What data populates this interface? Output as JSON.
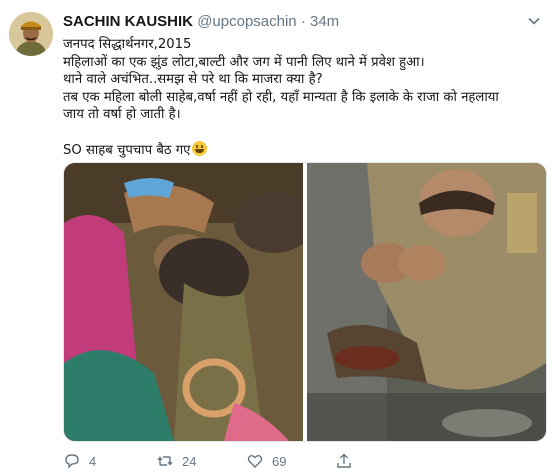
{
  "user": {
    "name": "SACHIN KAUSHIK",
    "handle": "@upcopsachin",
    "separator": "·",
    "time": "34m"
  },
  "tweet": {
    "lines": [
      "जनपद सिद्धार्थनगर,2015",
      "महिलाओं का एक झुंड लोटा,बाल्टी और जग में पानी लिए थाने में प्रवेश हुआ।",
      "थाने वाले अचंभित..समझ से परे था कि माजरा क्या है?",
      "तब एक महिला बोली साहेब,वर्षा नहीं हो रही, यहाँ मान्यता है कि इलाके के राजा को नहलाया",
      "जाय तो वर्षा हो जाती है।"
    ],
    "last_line": "SO साहब चुपचाप बैठ गए"
  },
  "actions": {
    "reply_count": "4",
    "retweet_count": "24",
    "like_count": "69"
  },
  "colors": {
    "text": "#14171a",
    "secondary": "#657786",
    "border": "#e1e8ed"
  },
  "icons": [
    "chevron-down-icon",
    "reply-icon",
    "retweet-icon",
    "like-icon",
    "share-icon",
    "grinning-emoji-icon"
  ]
}
